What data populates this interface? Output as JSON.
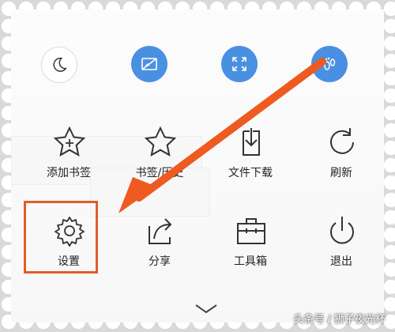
{
  "colors": {
    "accent_blue": "#4a90e2",
    "arrow_orange": "#ee5a1f",
    "highlight_border": "#e35b2a",
    "icon_gray": "#333333"
  },
  "top_row": [
    {
      "name": "night-mode-button",
      "icon": "moon-icon"
    },
    {
      "name": "no-image-button",
      "icon": "no-image-icon"
    },
    {
      "name": "fullscreen-button",
      "icon": "fullscreen-icon"
    },
    {
      "name": "footprint-button",
      "icon": "footprint-icon"
    }
  ],
  "menu_rows": [
    [
      {
        "label": "添加书签",
        "icon": "add-bookmark-star-icon"
      },
      {
        "label": "书签/历史",
        "icon": "star-icon"
      },
      {
        "label": "文件下载",
        "icon": "download-icon"
      },
      {
        "label": "刷新",
        "icon": "refresh-icon"
      }
    ],
    [
      {
        "label": "设置",
        "icon": "gear-icon"
      },
      {
        "label": "分享",
        "icon": "share-icon"
      },
      {
        "label": "工具箱",
        "icon": "toolbox-icon"
      },
      {
        "label": "退出",
        "icon": "power-icon"
      }
    ]
  ],
  "watermark": "头条号 / 狮子夜光杯"
}
